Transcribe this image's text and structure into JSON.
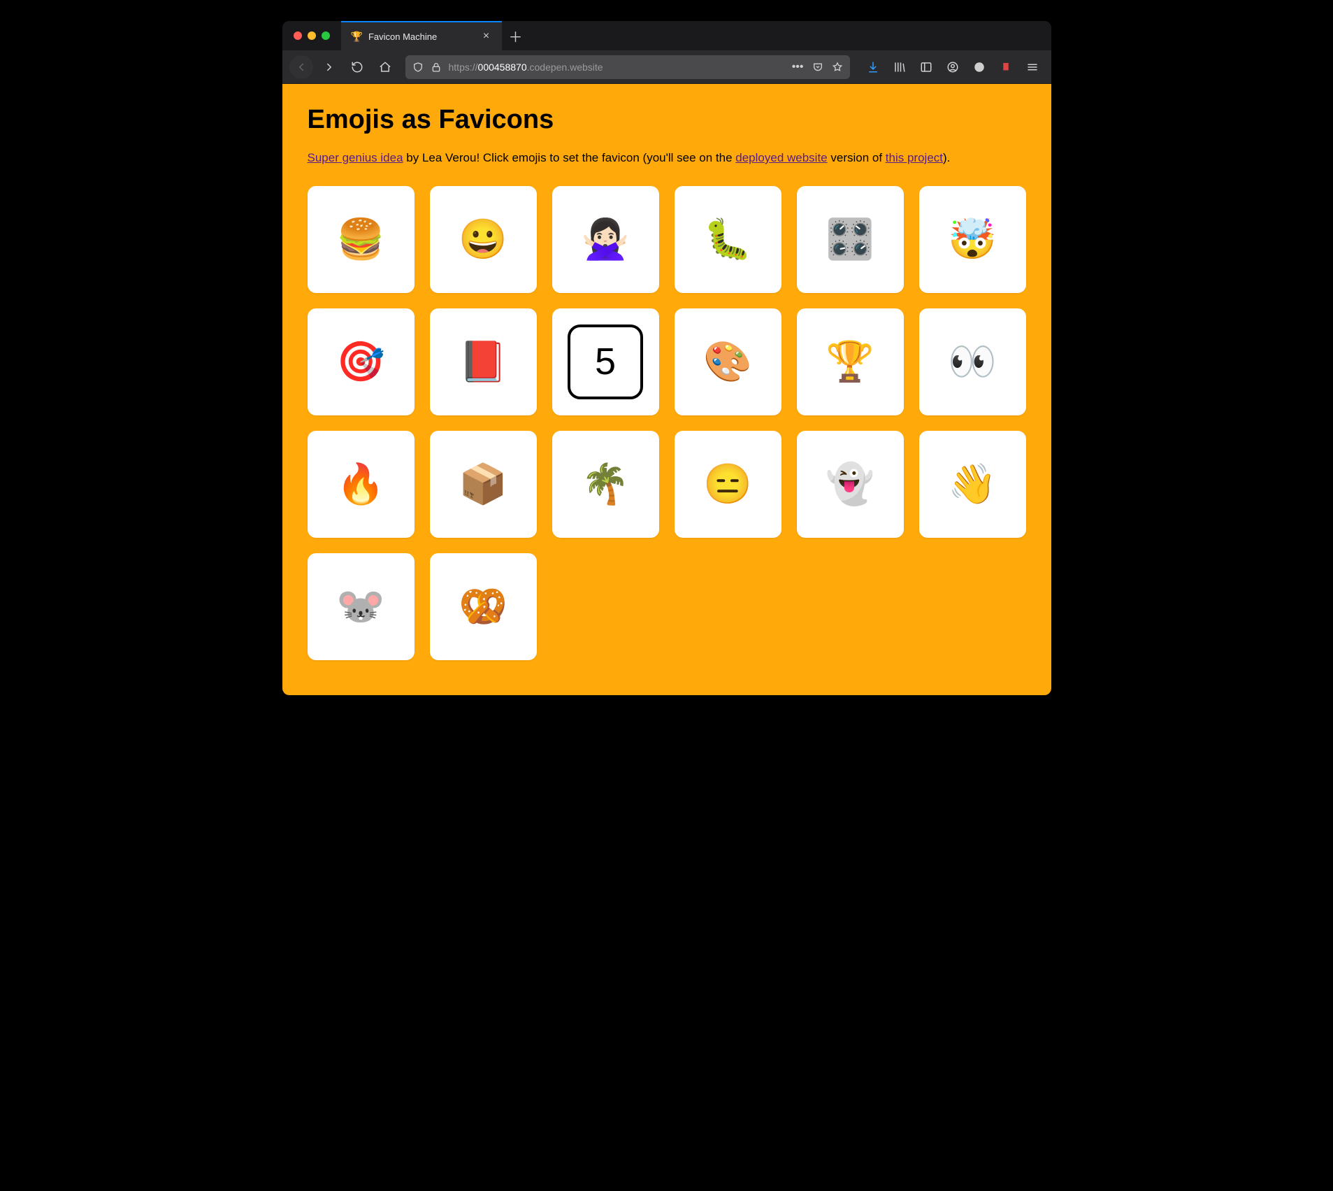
{
  "browser": {
    "tab": {
      "favicon": "🏆",
      "title": "Favicon Machine"
    },
    "url": {
      "protocol": "https://",
      "host": "000458870",
      "suffix": ".codepen.website"
    }
  },
  "page": {
    "heading": "Emojis as Favicons",
    "intro": {
      "link1_text": "Super genius idea",
      "text1": " by Lea Verou! Click emojis to set the favicon (you'll see on the ",
      "link2_text": "deployed website",
      "text2": " version of ",
      "link3_text": "this project",
      "text3": ")."
    },
    "emojis": [
      {
        "name": "hamburger",
        "char": "🍔"
      },
      {
        "name": "grinning-face",
        "char": "😀"
      },
      {
        "name": "person-gesturing-no",
        "char": "🙅🏻‍♀️"
      },
      {
        "name": "bug-caterpillar",
        "char": "🐛"
      },
      {
        "name": "control-knobs",
        "char": "🎛️"
      },
      {
        "name": "exploding-head",
        "char": "🤯"
      },
      {
        "name": "bullseye",
        "char": "🎯"
      },
      {
        "name": "closed-book",
        "char": "📕"
      },
      {
        "name": "keycap-5",
        "char": "5"
      },
      {
        "name": "artist-palette",
        "char": "🎨"
      },
      {
        "name": "trophy",
        "char": "🏆"
      },
      {
        "name": "eyes",
        "char": "👀"
      },
      {
        "name": "fire",
        "char": "🔥"
      },
      {
        "name": "package",
        "char": "📦"
      },
      {
        "name": "palm-tree",
        "char": "🌴"
      },
      {
        "name": "expressionless-face",
        "char": "😑"
      },
      {
        "name": "ghost",
        "char": "👻"
      },
      {
        "name": "waving-hand",
        "char": "👋"
      },
      {
        "name": "mouse-face",
        "char": "🐭"
      },
      {
        "name": "pretzel",
        "char": "🥨"
      }
    ]
  }
}
